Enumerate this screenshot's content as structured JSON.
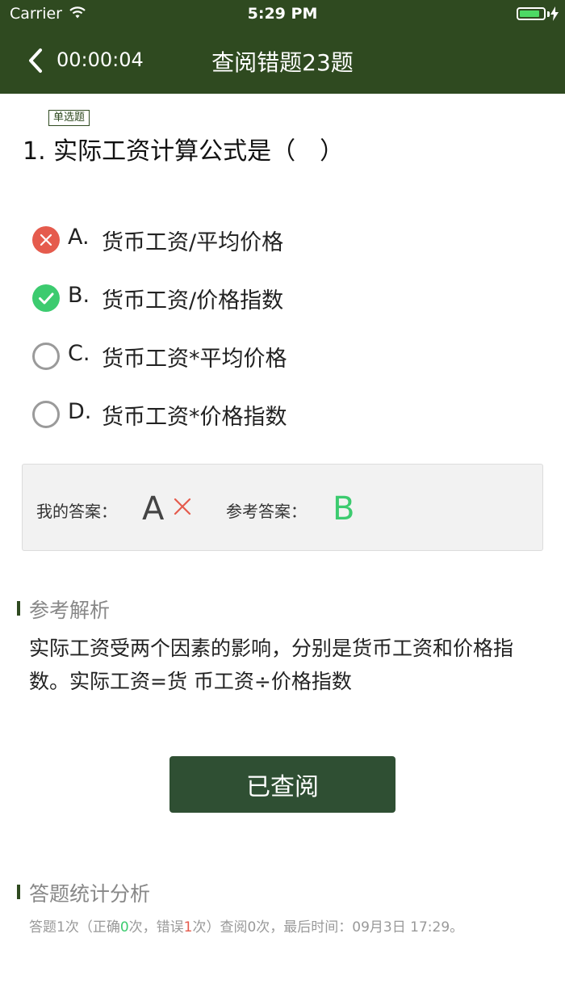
{
  "status_bar": {
    "carrier": "Carrier",
    "time": "5:29 PM",
    "battery_level": 0.85
  },
  "header": {
    "timer": "00:00:04",
    "title": "查阅错题23题"
  },
  "question": {
    "type_badge": "单选题",
    "text": "1. 实际工资计算公式是（　）",
    "options": [
      {
        "letter": "A.",
        "text": "货币工资/平均价格",
        "state": "wrong"
      },
      {
        "letter": "B.",
        "text": "货币工资/价格指数",
        "state": "correct"
      },
      {
        "letter": "C.",
        "text": "货币工资*平均价格",
        "state": "unselected"
      },
      {
        "letter": "D.",
        "text": "货币工资*价格指数",
        "state": "unselected"
      }
    ]
  },
  "answer": {
    "my_label": "我的答案：",
    "my_value": "A",
    "ref_label": "参考答案：",
    "ref_value": "B"
  },
  "analysis": {
    "title": "参考解析",
    "text": "实际工资受两个因素的影响，分别是货币工资和价格指数。实际工资=货 币工资÷价格指数"
  },
  "review_button": {
    "label": "已查阅"
  },
  "stats": {
    "title": "答题统计分析",
    "prefix": "答题1次（正确",
    "correct_count": "0",
    "mid": "次，错误",
    "wrong_count": "1",
    "suffix": "次）查阅0次，最后时间：09月3日 17:29。"
  },
  "colors": {
    "header": "#2f4a20",
    "correct": "#3ccb6f",
    "wrong": "#e55b4d",
    "button": "#2f4f33"
  }
}
